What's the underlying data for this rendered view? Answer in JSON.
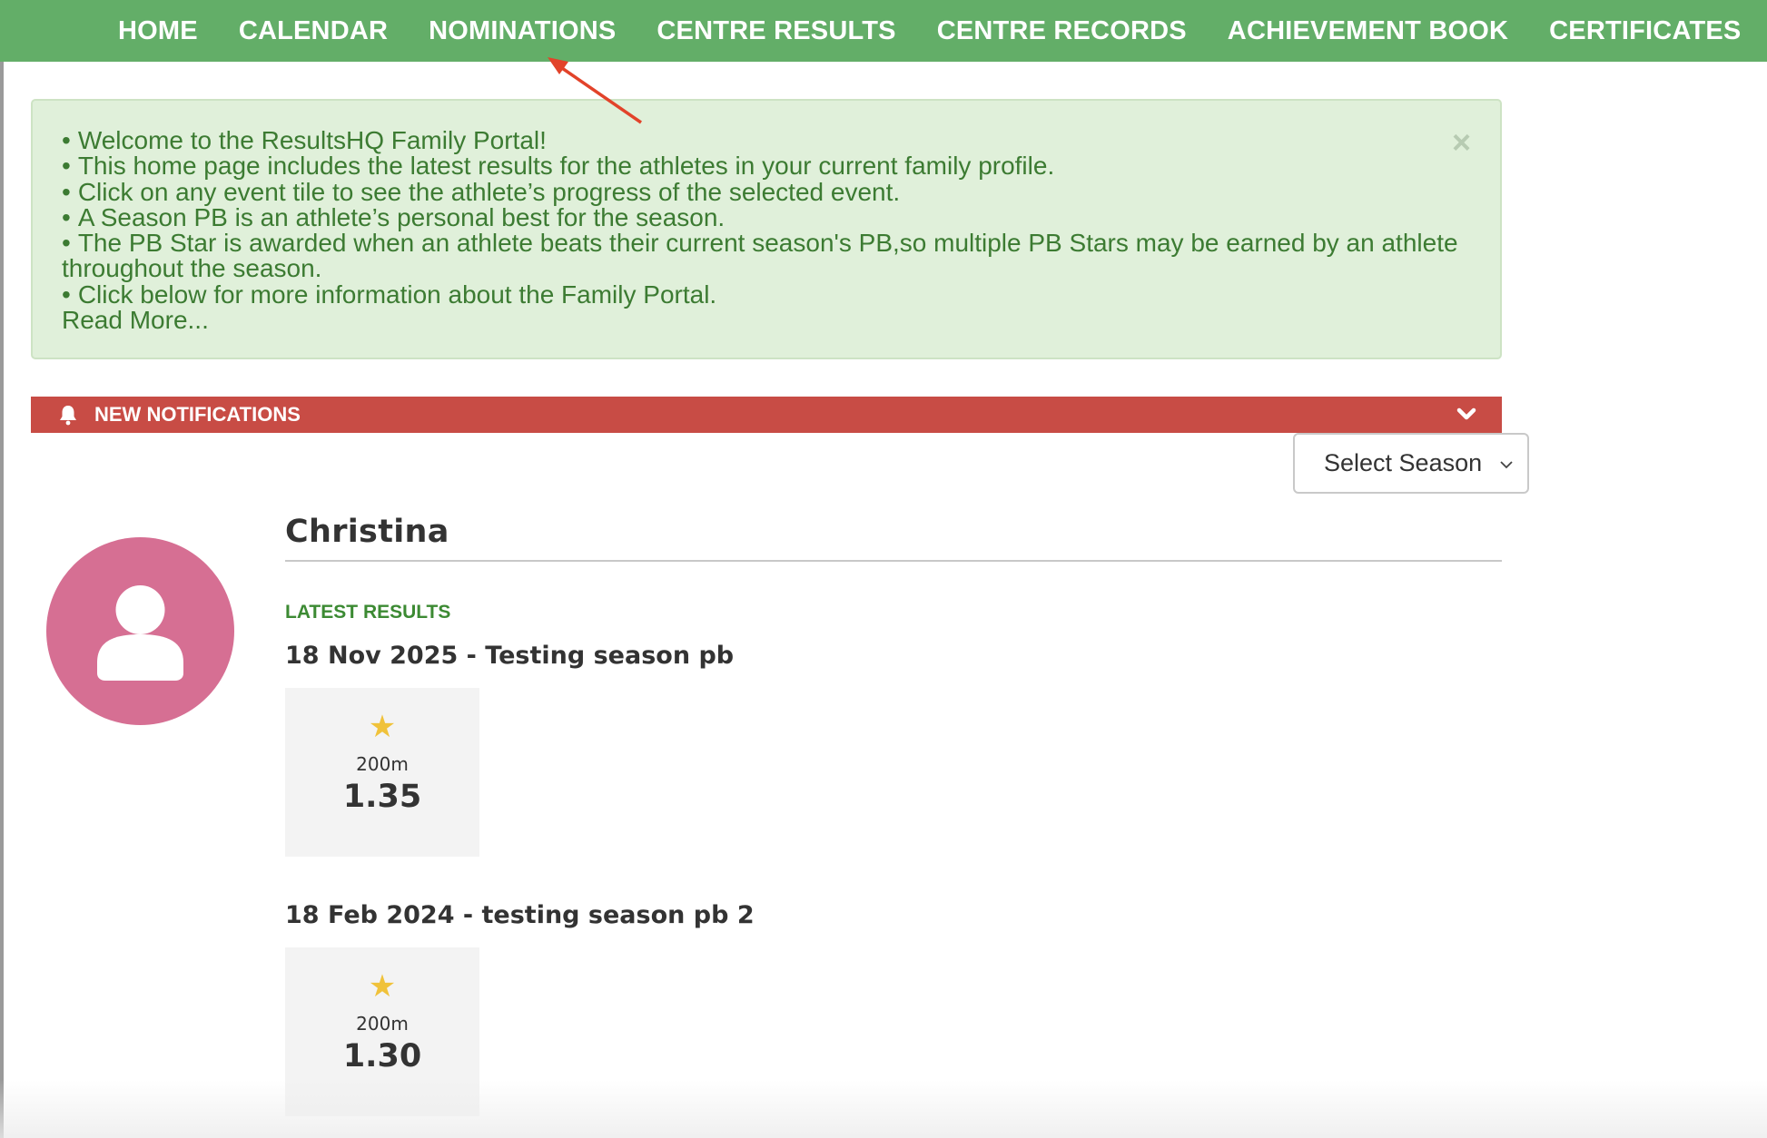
{
  "nav": {
    "items": [
      {
        "label": "HOME"
      },
      {
        "label": "CALENDAR"
      },
      {
        "label": "NOMINATIONS"
      },
      {
        "label": "CENTRE RESULTS"
      },
      {
        "label": "CENTRE RECORDS"
      },
      {
        "label": "ACHIEVEMENT BOOK"
      },
      {
        "label": "CERTIFICATES"
      }
    ]
  },
  "welcome": {
    "bullets": [
      "Welcome to the ResultsHQ Family Portal!",
      "This home page includes the latest results for the athletes in your current family profile.",
      "Click on any event tile to see the athlete’s progress of the selected event.",
      "A Season PB is an athlete’s personal best for the season.",
      "The PB Star is awarded when an athlete beats their current season's PB,so multiple PB Stars may be earned by an athlete throughout the season.",
      "Click below for more information about the Family Portal."
    ],
    "read_more": "Read More...",
    "close_glyph": "×"
  },
  "notifications": {
    "label": "NEW NOTIFICATIONS",
    "icon": "bell-icon",
    "toggle_icon": "chevron-down-icon",
    "bar_color": "#c84c45"
  },
  "season_select": {
    "value": "Select Season"
  },
  "athlete": {
    "name": "Christina",
    "avatar_icon": "user-icon",
    "avatar_color": "#d66f93",
    "latest_results_label": "LATEST RESULTS",
    "meets": [
      {
        "title": "18 Nov 2025 - Testing season pb",
        "results": [
          {
            "pb_star": "★",
            "event": "200m",
            "time": "1.35"
          }
        ]
      },
      {
        "title": "18 Feb 2024 - testing season pb 2",
        "results": [
          {
            "pb_star": "★",
            "event": "200m",
            "time": "1.30"
          }
        ]
      }
    ]
  },
  "colors": {
    "nav_green": "#63ae68",
    "panel_bg": "#e0f0da",
    "panel_text": "#3c7b32",
    "star": "#f0c23a",
    "annotation_arrow": "#e2432a"
  }
}
